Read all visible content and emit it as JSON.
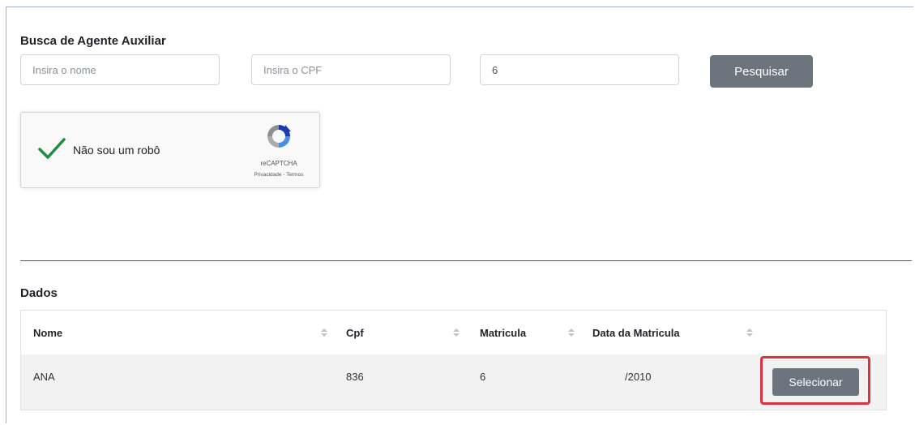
{
  "search": {
    "title": "Busca de Agente Auxiliar",
    "name_placeholder": "Insira o nome",
    "cpf_placeholder": "Insira o CPF",
    "matricula_value": "6",
    "button_label": "Pesquisar"
  },
  "captcha": {
    "label": "Não sou um robô",
    "brand": "reCAPTCHA",
    "links": "Privacidade - Termos",
    "checked": true
  },
  "dados": {
    "title": "Dados",
    "columns": [
      "Nome",
      "Cpf",
      "Matricula",
      "Data da Matricula"
    ],
    "rows": [
      {
        "nome": "ANA",
        "cpf": "836",
        "matricula": "6",
        "data": "/2010",
        "action": "Selecionar"
      }
    ]
  },
  "colors": {
    "button": "#6c757d",
    "highlight": "#d9333f",
    "check": "#1e8e3e"
  }
}
